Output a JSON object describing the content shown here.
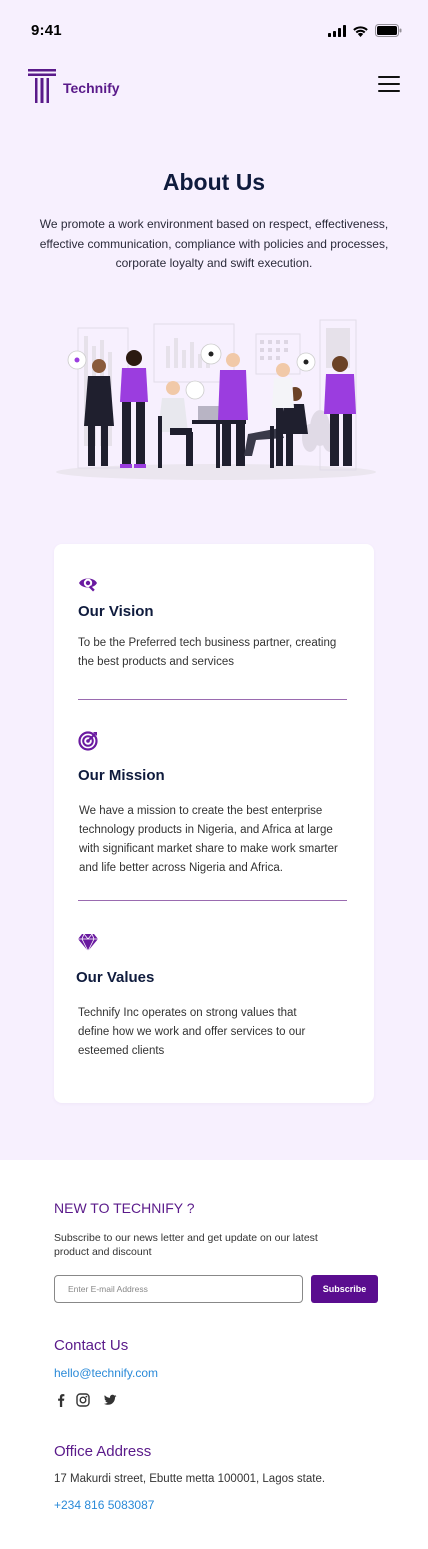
{
  "status_bar": {
    "time": "9:41"
  },
  "nav": {
    "brand": "Technify"
  },
  "about": {
    "title": "About Us",
    "intro": "We promote a work environment based on respect, effectiveness, effective communication, compliance with policies and processes, corporate loyalty and swift execution."
  },
  "sections": [
    {
      "heading": "Our Vision",
      "icon": "eye-icon",
      "text": "To be the Preferred tech business partner, creating the best products and services"
    },
    {
      "heading": "Our Mission",
      "icon": "target-icon",
      "text": "We have a mission to create the best enterprise technology products in Nigeria, and Africa at large with significant market share to make work smarter and life better across Nigeria and Africa."
    },
    {
      "heading": "Our Values",
      "icon": "diamond-icon",
      "text": "Technify Inc  operates on strong values that define how we work and offer services to our esteemed clients"
    }
  ],
  "newsletter": {
    "heading": "NEW TO TECHNIFY ?",
    "subtitle": "Subscribe to our news letter and get update on our latest product and discount",
    "email_placeholder": "Enter E-mail Address",
    "subscribe_label": "Subscribe"
  },
  "contact": {
    "heading": "Contact Us",
    "email": "hello@technify.com",
    "socials": [
      "facebook-icon",
      "instagram-icon",
      "twitter-icon"
    ]
  },
  "office": {
    "heading": "Office Address",
    "address": "17 Makurdi street, Ebutte metta 100001, Lagos state.",
    "phone": "+234 816 5083087"
  },
  "colors": {
    "brand_purple": "#5a1a8a",
    "accent_purple": "#9b3ddf",
    "hero_background": "#f7f0fe",
    "navy_text": "#0f1b3d",
    "link_blue": "#2a8ad8"
  }
}
